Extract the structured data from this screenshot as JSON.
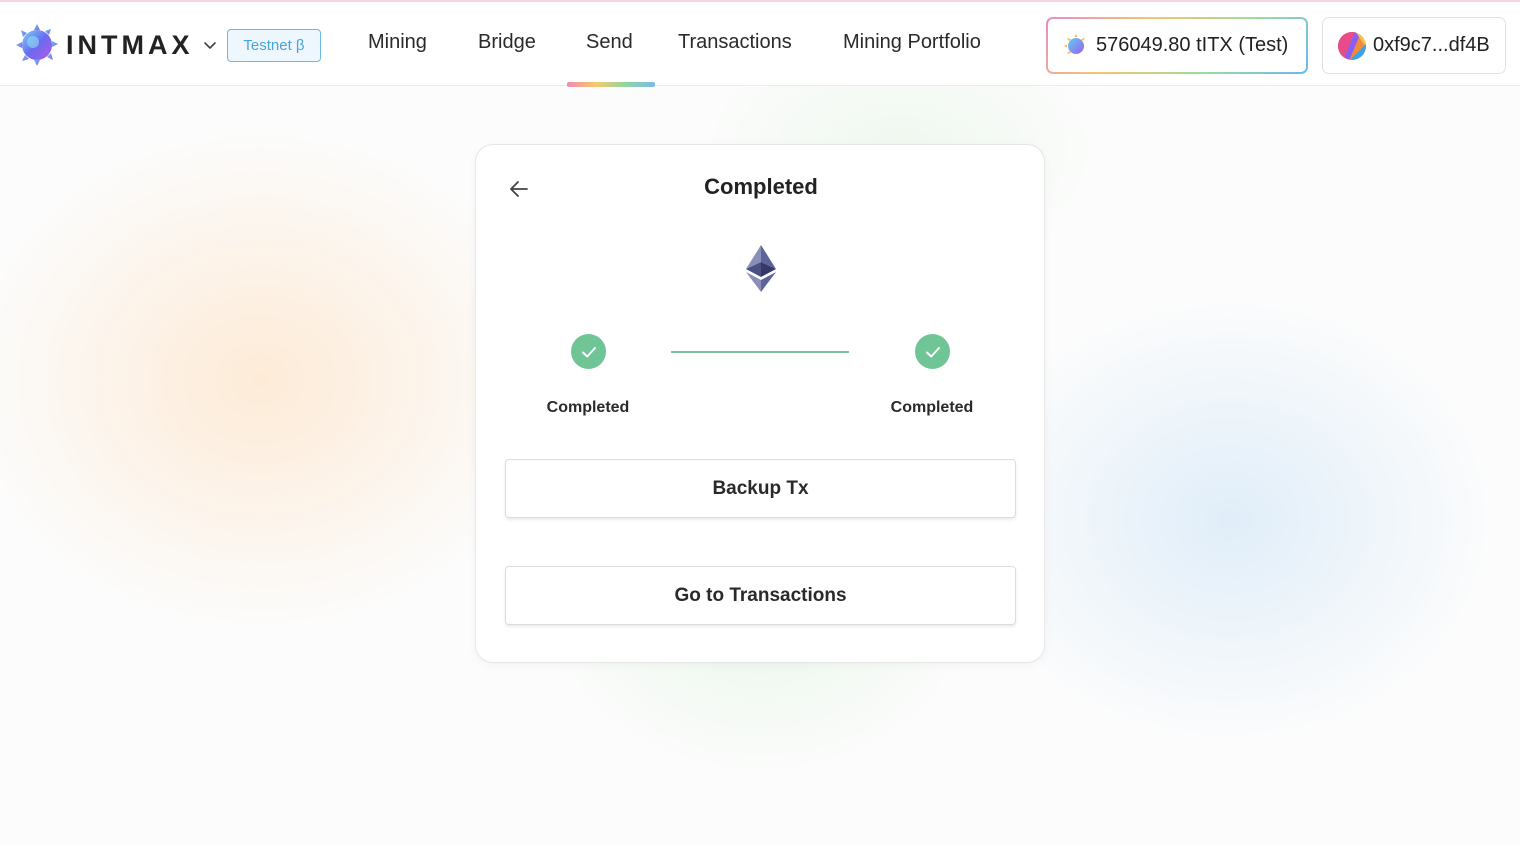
{
  "app": {
    "logo_text": "INTMAX",
    "network_badge": "Testnet β"
  },
  "nav": {
    "items": [
      {
        "label": "Mining",
        "active": false
      },
      {
        "label": "Bridge",
        "active": false
      },
      {
        "label": "Send",
        "active": true
      },
      {
        "label": "Transactions",
        "active": false
      },
      {
        "label": "Mining Portfolio",
        "active": false
      }
    ]
  },
  "wallet": {
    "balance": "576049.80 tITX (Test)",
    "address": "0xf9c7...df4B"
  },
  "card": {
    "title": "Completed",
    "token_icon": "ethereum-icon",
    "steps": [
      {
        "label": "Completed",
        "status": "done"
      },
      {
        "label": "Completed",
        "status": "done"
      }
    ],
    "backup_button": "Backup Tx",
    "transactions_button": "Go to Transactions"
  },
  "colors": {
    "success": "#6fc595",
    "badge": "#4aa3dd",
    "text": "#222222"
  }
}
